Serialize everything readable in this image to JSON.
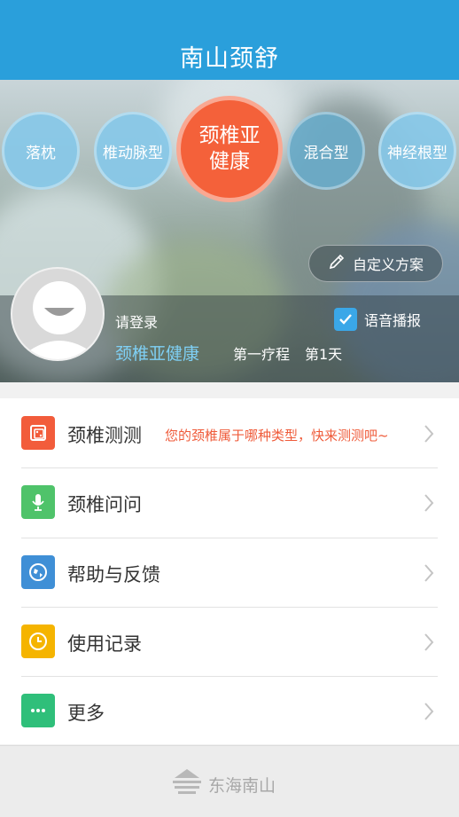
{
  "header": {
    "title": "南山颈舒"
  },
  "types": [
    {
      "label": "落枕"
    },
    {
      "label": "椎动脉型"
    },
    {
      "label_line1": "颈椎亚",
      "label_line2": "健康"
    },
    {
      "label": "混合型"
    },
    {
      "label": "神经根型"
    }
  ],
  "custom_plan_label": "自定义方案",
  "profile": {
    "login_text": "请登录",
    "plan_name": "颈椎亚健康",
    "course": "第一疗程",
    "day": "第1天",
    "voice_label": "语音播报"
  },
  "menu": {
    "items": [
      {
        "label": "颈椎测测",
        "subtitle": "您的颈椎属于哪种类型，快来测测吧~",
        "color": "#f25c3b",
        "icon": "dice-icon"
      },
      {
        "label": "颈椎问问",
        "color": "#4fc36a",
        "icon": "microphone-icon"
      },
      {
        "label": "帮助与反馈",
        "color": "#3f8fd6",
        "icon": "globe-icon"
      },
      {
        "label": "使用记录",
        "color": "#f5b400",
        "icon": "clock-icon"
      },
      {
        "label": "更多",
        "color": "#2fbf7a",
        "icon": "more-icon"
      }
    ]
  },
  "footer": {
    "brand": "东海南山"
  }
}
